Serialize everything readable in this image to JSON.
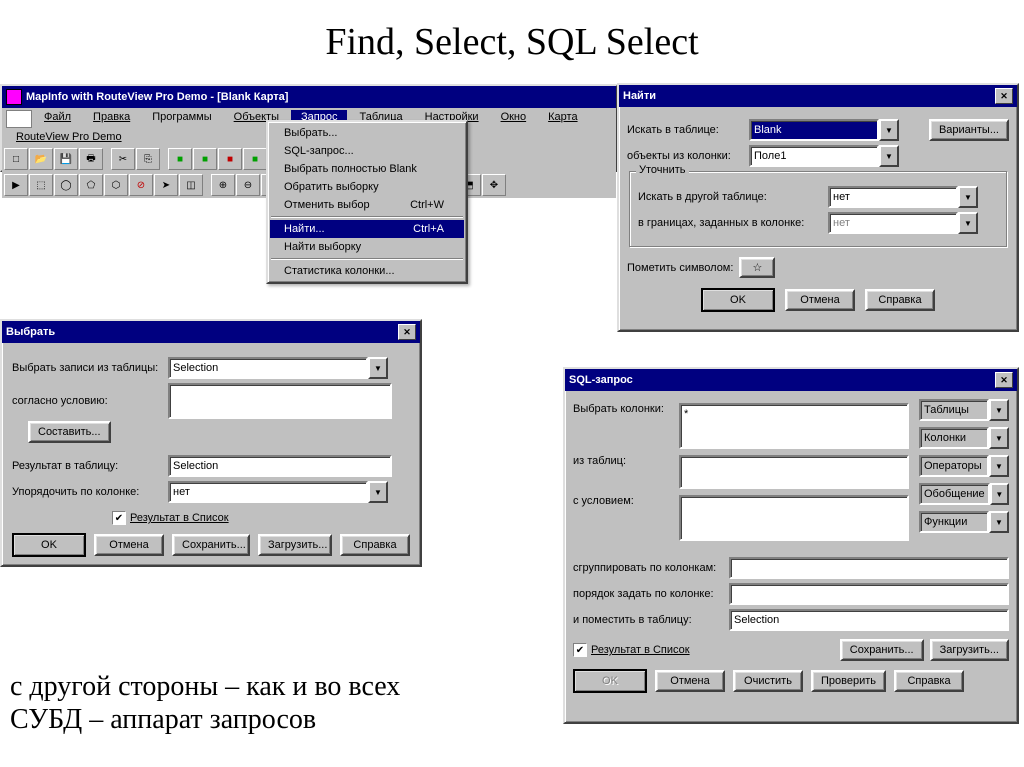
{
  "slide": {
    "title": "Find, Select, SQL Select",
    "caption_line1": "с другой стороны – как и во всех",
    "caption_line2": "СУБД – аппарат запросов"
  },
  "main_window": {
    "title": "MapInfo with RouteView Pro Demo - [Blank Карта]",
    "menus": [
      "Файл",
      "Правка",
      "Программы",
      "Объекты",
      "Запрос",
      "Таблица",
      "Настройки",
      "Окно",
      "Карта",
      "RouteView Pro Demo"
    ]
  },
  "query_menu": {
    "items": [
      {
        "label": "Выбрать...",
        "shortcut": ""
      },
      {
        "label": "SQL-запрос...",
        "shortcut": ""
      },
      {
        "label": "Выбрать полностью Blank",
        "shortcut": ""
      },
      {
        "label": "Обратить выборку",
        "shortcut": ""
      },
      {
        "label": "Отменить выбор",
        "shortcut": "Ctrl+W"
      },
      {
        "label": "Найти...",
        "shortcut": "Ctrl+A",
        "highlight": true
      },
      {
        "label": "Найти выборку",
        "shortcut": ""
      },
      {
        "label": "Статистика колонки...",
        "shortcut": ""
      }
    ]
  },
  "find_dialog": {
    "title": "Найти",
    "search_in_table_label": "Искать в таблице:",
    "search_in_table_value": "Blank",
    "objects_from_col_label": "объекты из колонки:",
    "objects_from_col_value": "Поле1",
    "variants_btn": "Варианты...",
    "refine_group": "Уточнить",
    "search_other_label": "Искать в другой таблице:",
    "search_other_value": "нет",
    "bounds_label": "в границах, заданных в колонке:",
    "bounds_value": "нет",
    "mark_symbol_label": "Пометить символом:",
    "star": "☆",
    "ok": "OK",
    "cancel": "Отмена",
    "help": "Справка"
  },
  "select_dialog": {
    "title": "Выбрать",
    "from_table_label": "Выбрать записи из таблицы:",
    "from_table_value": "Selection",
    "condition_label": "согласно условию:",
    "compose_btn": "Составить...",
    "result_table_label": "Результат в таблицу:",
    "result_table_value": "Selection",
    "order_col_label": "Упорядочить по колонке:",
    "order_col_value": "нет",
    "result_list": "Результат в Список",
    "ok": "OK",
    "cancel": "Отмена",
    "save": "Сохранить...",
    "load": "Загрузить...",
    "help": "Справка"
  },
  "sql_dialog": {
    "title": "SQL-запрос",
    "select_cols_label": "Выбрать колонки:",
    "select_cols_value": "*",
    "from_tables_label": "из таблиц:",
    "where_label": "с условием:",
    "groupby_label": "сгруппировать по колонкам:",
    "orderby_label": "порядок задать по колонке:",
    "into_label": "и поместить в таблицу:",
    "into_value": "Selection",
    "result_list": "Результат в Список",
    "side_btns": [
      "Таблицы",
      "Колонки",
      "Операторы",
      "Обобщение",
      "Функции"
    ],
    "save": "Сохранить...",
    "load": "Загрузить...",
    "ok": "OK",
    "cancel": "Отмена",
    "clear": "Очистить",
    "verify": "Проверить",
    "help": "Справка"
  }
}
